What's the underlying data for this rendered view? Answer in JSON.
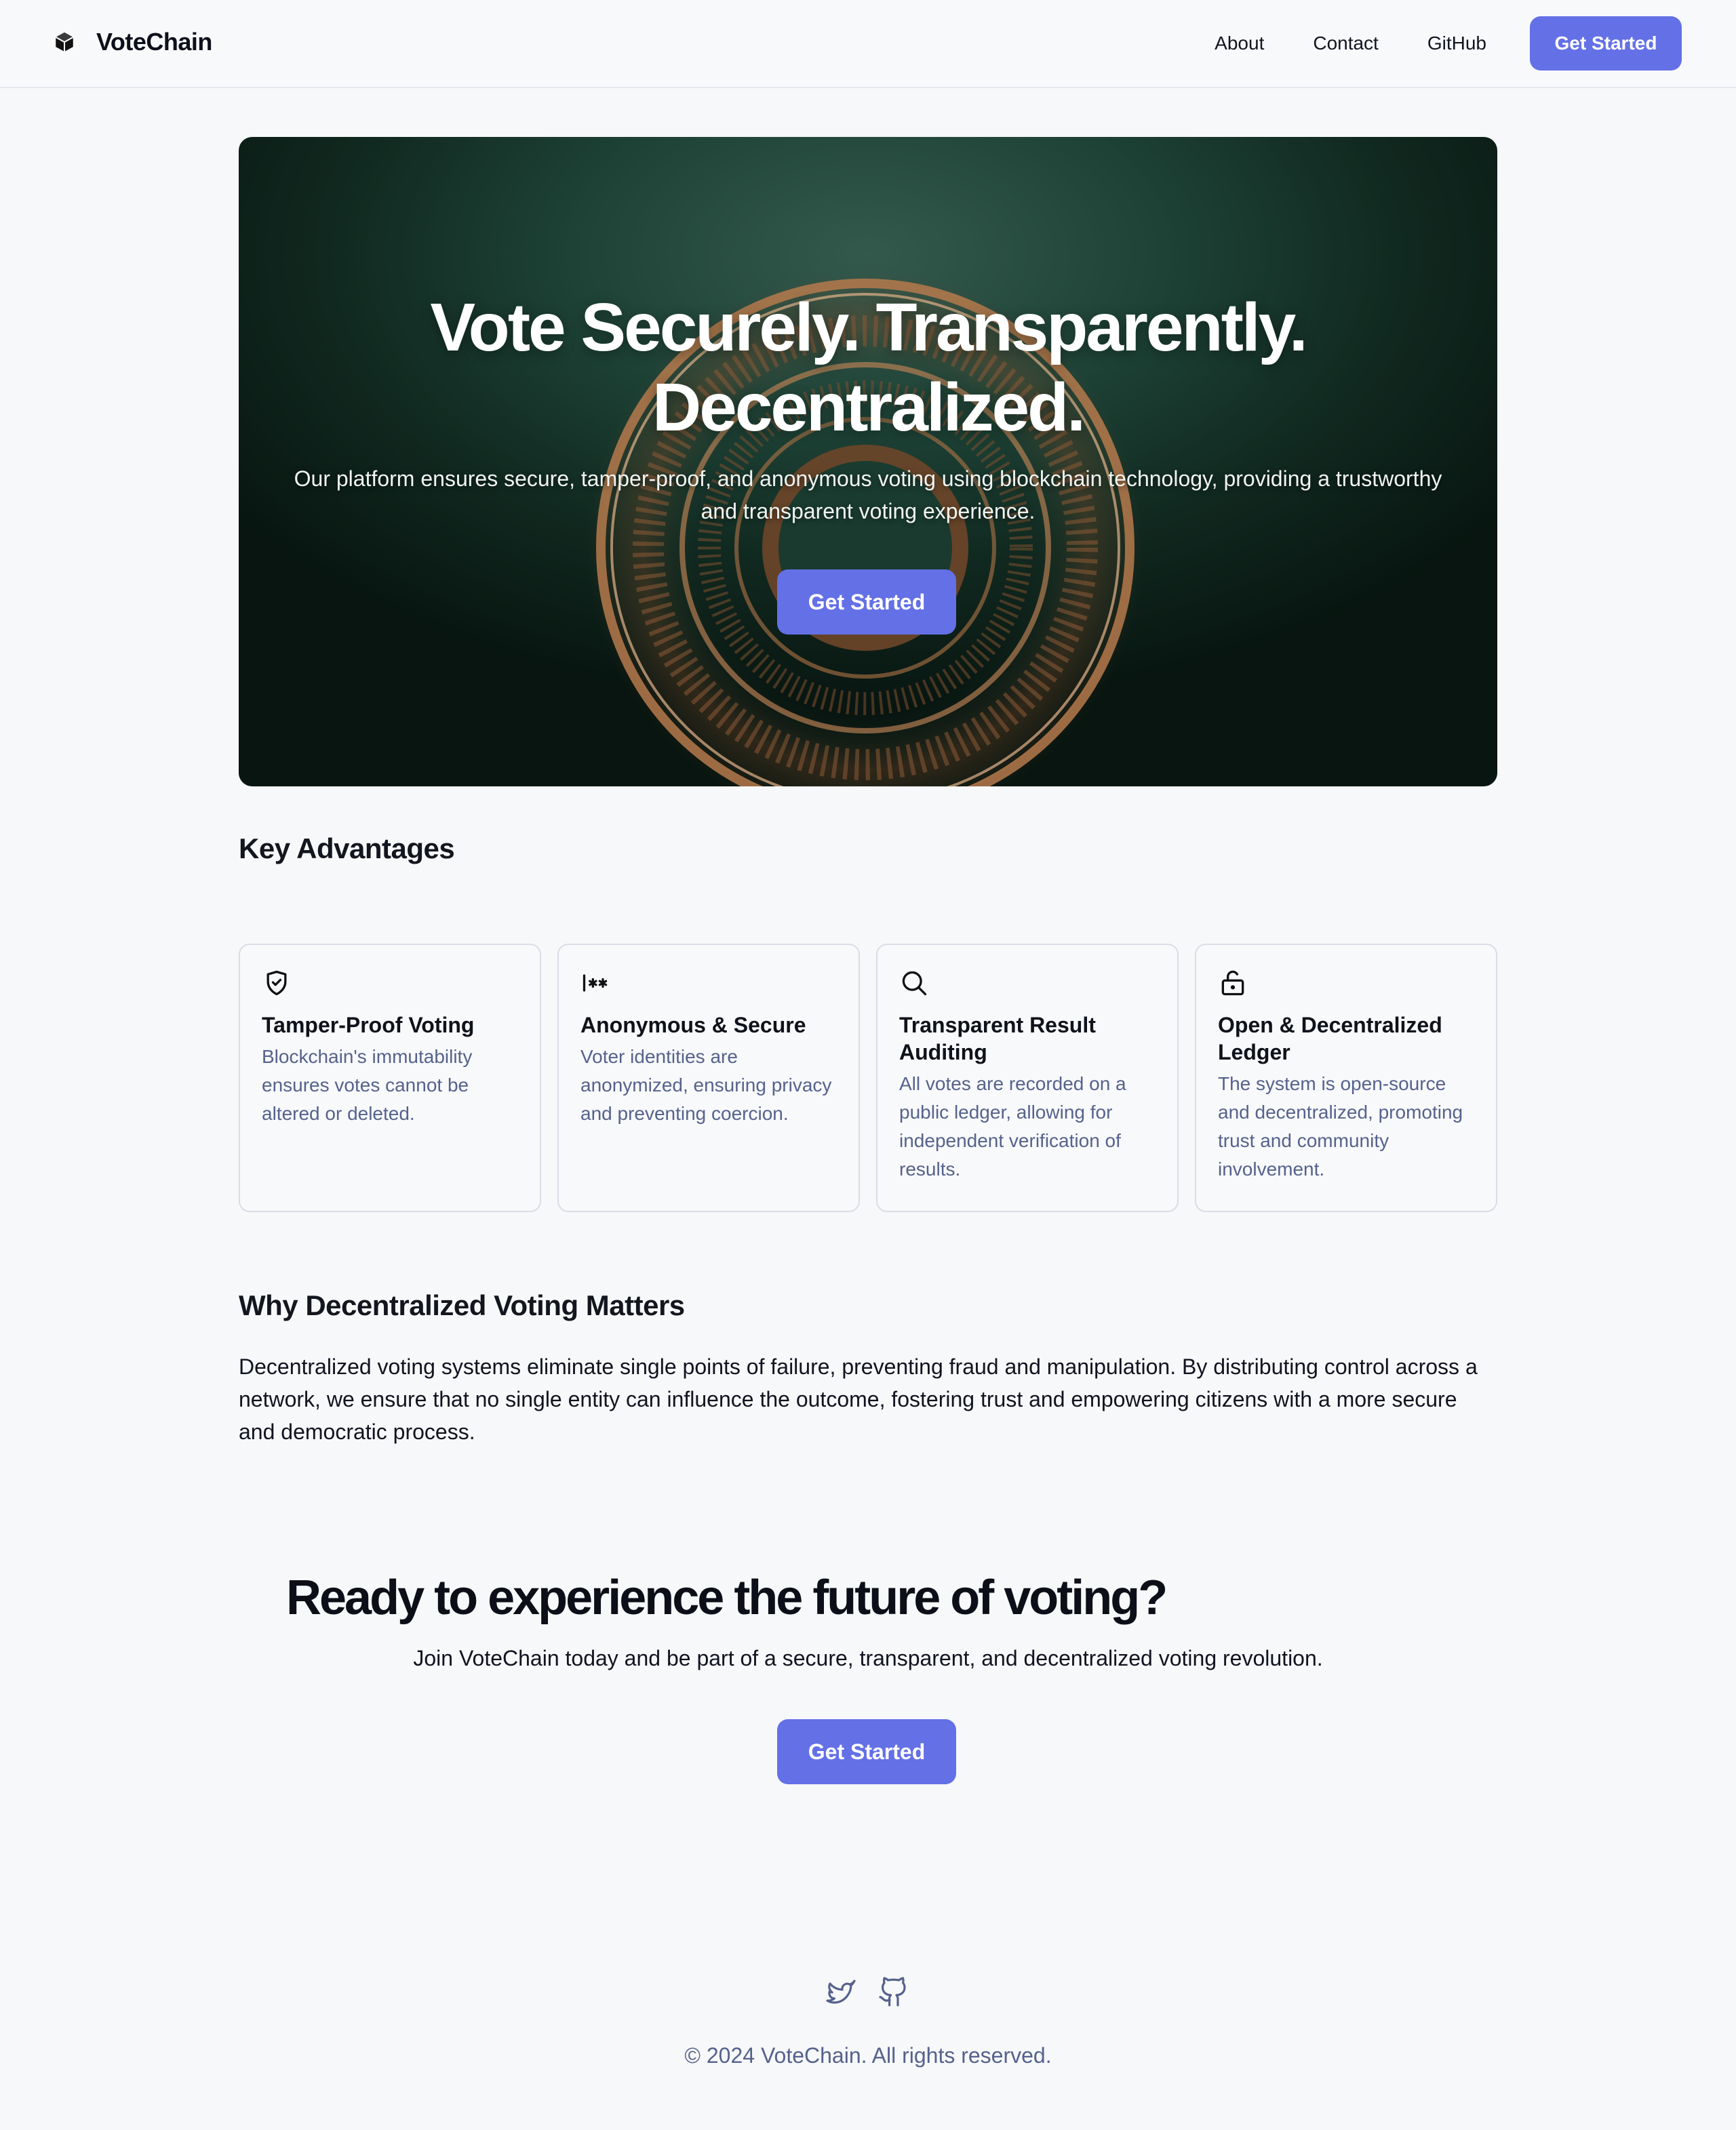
{
  "header": {
    "brand_name": "VoteChain",
    "brand_icon": "cube-icon",
    "nav": [
      {
        "label": "About"
      },
      {
        "label": "Contact"
      },
      {
        "label": "GitHub"
      }
    ],
    "cta_label": "Get Started"
  },
  "hero": {
    "title_line1": "Vote Securely. Transparently.",
    "title_line2": "Decentralized.",
    "subtitle": "Our platform ensures secure, tamper-proof, and anonymous voting using blockchain technology, providing a trustworthy and transparent voting experience.",
    "cta_label": "Get Started"
  },
  "advantages": {
    "title": "Key Advantages",
    "cards": [
      {
        "icon": "shield-check-icon",
        "title": "Tamper-Proof Voting",
        "desc": "Blockchain's immutability ensures votes cannot be altered or deleted."
      },
      {
        "icon": "password-icon",
        "title": "Anonymous & Secure",
        "desc": "Voter identities are anonymized, ensuring privacy and preventing coercion."
      },
      {
        "icon": "search-icon",
        "title": "Transparent Result Auditing",
        "desc": "All votes are recorded on a public ledger, allowing for independent verification of results."
      },
      {
        "icon": "unlock-icon",
        "title": "Open & Decentralized Ledger",
        "desc": "The system is open-source and decentralized, promoting trust and community involvement."
      }
    ]
  },
  "why": {
    "title": "Why Decentralized Voting Matters",
    "body": "Decentralized voting systems eliminate single points of failure, preventing fraud and manipulation. By distributing control across a network, we ensure that no single entity can influence the outcome, fostering trust and empowering citizens with a more secure and democratic process."
  },
  "cta": {
    "title": "Ready to experience the future of voting?",
    "subtitle": "Join VoteChain today and be part of a secure, transparent, and decentralized voting revolution.",
    "button_label": "Get Started"
  },
  "footer": {
    "social_icons": [
      "twitter-icon",
      "github-icon"
    ],
    "copyright": "© 2024 VoteChain. All rights reserved."
  },
  "colors": {
    "accent": "#6470e6",
    "muted_text": "#55628c",
    "background": "#f7f8fa"
  }
}
